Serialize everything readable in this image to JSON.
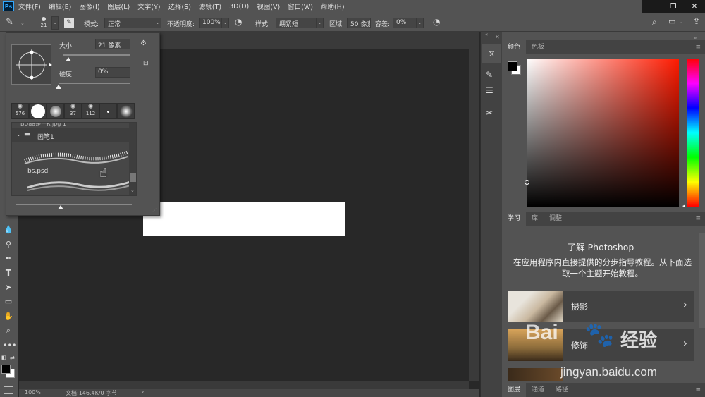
{
  "menu": [
    "文件(F)",
    "编辑(E)",
    "图像(I)",
    "图层(L)",
    "文字(Y)",
    "选择(S)",
    "滤镜(T)",
    "3D(D)",
    "视图(V)",
    "窗口(W)",
    "帮助(H)"
  ],
  "app_logo": "Ps",
  "window_buttons": {
    "minimize": "─",
    "restore": "❐",
    "close": "✕"
  },
  "options": {
    "brush_size": "21",
    "mode_label": "模式:",
    "mode_value": "正常",
    "opacity_label": "不透明度:",
    "opacity_value": "100%",
    "style_label": "样式:",
    "style_value": "绷紧短",
    "area_label": "区域:",
    "area_value": "50 像素",
    "tolerance_label": "容差:",
    "tolerance_value": "0%"
  },
  "brush_popup": {
    "size_label": "大小:",
    "size_value": "21 像素",
    "hardness_label": "硬度:",
    "hardness_value": "0%",
    "size_fraction": 0.08,
    "hardness_fraction": 0.0,
    "presets": [
      "576",
      "",
      "",
      "37",
      "112",
      "",
      ""
    ],
    "truncated_item": "BUaa是一R.jpg 1",
    "folder_name": "画笔1",
    "brush_file": "bs.psd"
  },
  "status": {
    "zoom": "100%",
    "doc": "文档:146.4K/0 字节"
  },
  "color_panel": {
    "tabs": [
      "颜色",
      "色板"
    ]
  },
  "learn_panel": {
    "tabs": [
      "学习",
      "库",
      "调整"
    ],
    "title": "了解 Photoshop",
    "desc": "在应用程序内直接提供的分步指导教程。从下面选取一个主题开始教程。",
    "cards": [
      {
        "label": "摄影"
      },
      {
        "label": "修饰"
      }
    ]
  },
  "bottom_tabs": [
    "图层",
    "通道",
    "路径"
  ],
  "watermark": {
    "site": "jingyan.baidu.com",
    "brand": "Bai",
    "brand2": "经验"
  },
  "colors": {
    "chrome": "#535353",
    "dark": "#282828",
    "accent": "#31a8ff"
  }
}
